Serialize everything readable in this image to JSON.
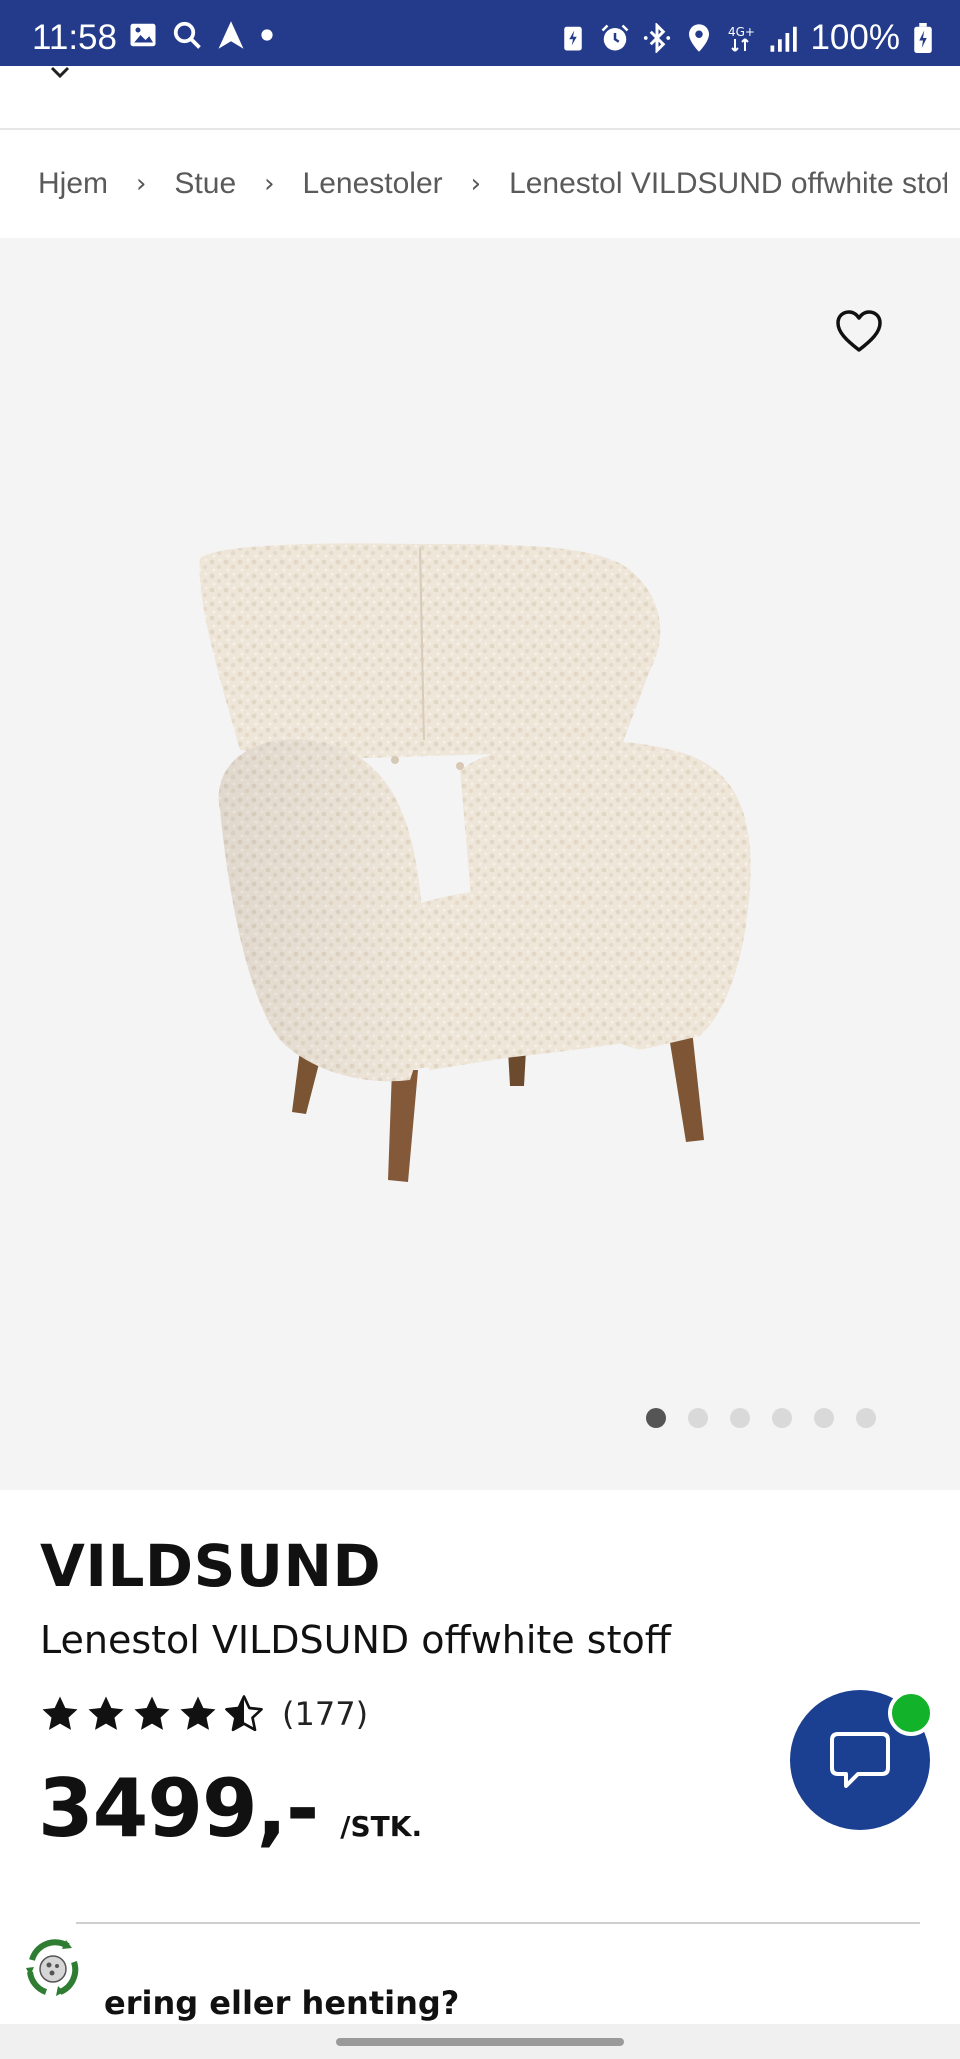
{
  "status_bar": {
    "time": "11:58",
    "battery": "100%",
    "network": "4G+",
    "left_icons": [
      "gallery-icon",
      "search-icon",
      "navigation-icon",
      "dot-icon"
    ],
    "right_icons": [
      "battery-saver-icon",
      "alarm-icon",
      "bluetooth-icon",
      "location-icon",
      "network-icon",
      "signal-icon",
      "battery-icon"
    ]
  },
  "breadcrumb": {
    "items": [
      "Hjem",
      "Stue",
      "Lenestoler",
      "Lenestol VILDSUND offwhite stoff"
    ],
    "separator": "›"
  },
  "gallery": {
    "image_count": 6,
    "active_index": 0,
    "favorite_icon": "heart-outline-icon",
    "image_subject": "armchair"
  },
  "product": {
    "brand": "VILDSUND",
    "name": "Lenestol VILDSUND offwhite stoff",
    "rating_value": 4.5,
    "rating_count": "(177)",
    "price": "3499,-",
    "price_unit": "/STK."
  },
  "chat": {
    "icon": "chat-bubble-icon",
    "status_color": "#12b22a",
    "button_color": "#1b3f91"
  },
  "delivery": {
    "heading_partial": "ering eller henting?"
  },
  "colors": {
    "status_bar": "#233b8a",
    "gallery_bg": "#f4f4f4",
    "dot_active": "#555555",
    "dot_inactive": "#d9d9d9"
  }
}
